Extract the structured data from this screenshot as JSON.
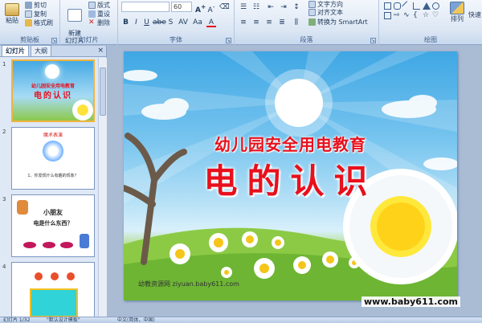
{
  "ribbon": {
    "clipboard": {
      "label": "剪贴板",
      "paste": "粘贴",
      "cut": "剪切",
      "copy": "复制",
      "format_painter": "格式刷"
    },
    "slides": {
      "label": "幻灯片",
      "new_slide": "新建\n幻灯片",
      "layout": "版式",
      "reset": "重设",
      "delete": "删除"
    },
    "font": {
      "label": "字体",
      "font_name": "",
      "font_size": "60"
    },
    "paragraph": {
      "label": "段落",
      "text_direction": "文字方向",
      "align_text": "对齐文本",
      "smartart": "转换为 SmartArt"
    },
    "drawing": {
      "label": "绘图",
      "arrange": "排列",
      "quick_styles": "快速"
    }
  },
  "left_pane": {
    "tabs": [
      "幻灯片",
      "大纲"
    ],
    "close": "×",
    "thumbs": [
      {
        "num": "1",
        "line1": "幼儿园安全用电教育",
        "line2": "电的认识"
      },
      {
        "num": "2",
        "line1": "魔术表演",
        "line2": "1、你发现什么有趣的现象？"
      },
      {
        "num": "3",
        "line1": "小朋友",
        "line2": "电是什么东西？"
      },
      {
        "num": "4",
        "line1": "",
        "line2": ""
      }
    ]
  },
  "slide": {
    "title1": "幼儿园安全用电教育",
    "title2": "电的认识",
    "footer": "幼教资源网 ziyuan.baby611.com"
  },
  "watermark": "www.baby611.com",
  "status": {
    "slide_info": "幻灯片 1/32",
    "theme": "\"默认设计模板\"",
    "language": "中文(简体，中国)"
  },
  "colors": {
    "title_red": "#e8101c",
    "ribbon_bg": "#dbe6f4",
    "selected_border": "#f2b33f"
  }
}
